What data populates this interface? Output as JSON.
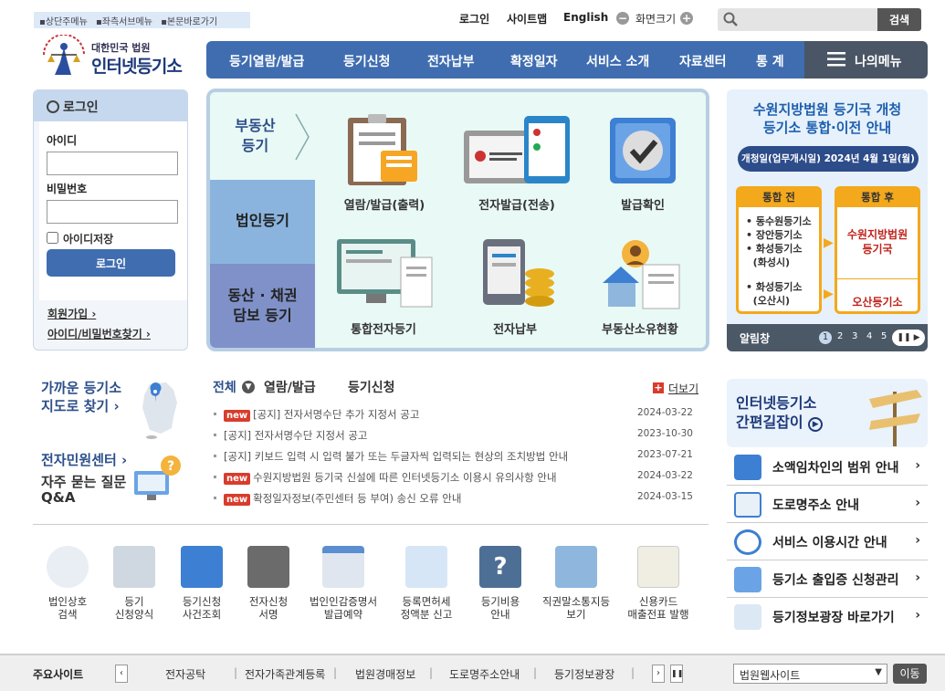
{
  "skip": [
    "상단주메뉴",
    "좌측서브메뉴",
    "본문바로가기"
  ],
  "util": {
    "login": "로그인",
    "sitemap": "사이트맵",
    "english": "English",
    "zoom_label": "화면크기",
    "zoom_minus": "−",
    "zoom_plus": "+",
    "search_button": "검색"
  },
  "logo": {
    "sub": "대한민국 법원",
    "main": "인터넷등기소"
  },
  "nav": {
    "items": [
      "등기열람/발급",
      "등기신청",
      "전자납부",
      "확정일자",
      "서비스 소개",
      "자료센터",
      "통 계"
    ],
    "my_menu": "나의메뉴"
  },
  "login": {
    "title": "로그인",
    "id_label": "아이디",
    "pw_label": "비밀번호",
    "save_id": "아이디저장",
    "button": "로그인",
    "join": "회원가입",
    "find": "아이디/비밀번호찾기"
  },
  "services": {
    "tabs": [
      "부동산\n등기",
      "법인등기",
      "동산 · 채권\n담보 등기"
    ],
    "items": [
      "열람/발급(출력)",
      "전자발급(전송)",
      "발급확인",
      "통합전자등기",
      "전자납부",
      "부동산소유현황"
    ]
  },
  "banner": {
    "title1": "수원지방법원 등기국 개청",
    "title2": "등기소 통합·이전 안내",
    "date": "개청일(업무개시일) 2024년 4월 1일(월)",
    "before": "통합 전",
    "after": "통합 후",
    "before_list1": "동수원등기소",
    "before_list2": "장안등기소",
    "before_list3": "화성등기소",
    "before_list4": "(화성시)",
    "before_list5": "화성등기소",
    "before_list6": "(오산시)",
    "after1": "수원지방법원\n등기국",
    "after2": "오산등기소",
    "footer": "알림창",
    "pages": [
      "1",
      "2",
      "3",
      "4",
      "5"
    ]
  },
  "quick": {
    "map1": "가까운 등기소",
    "map2": "지도로 찾기",
    "civil": "전자민원센터",
    "faq1": "자주 묻는 질문",
    "faq2": "Q&A"
  },
  "notice": {
    "tabs": [
      "전체",
      "열람/발급",
      "등기신청"
    ],
    "more": "더보기",
    "new_label": "new",
    "rows": [
      {
        "new": true,
        "text": "[공지] 전자서명수단 추가 지정서 공고",
        "date": "2024-03-22"
      },
      {
        "new": false,
        "text": "[공지] 전자서명수단 지정서 공고",
        "date": "2023-10-30"
      },
      {
        "new": false,
        "text": "[공지] 키보드 입력 시 입력 불가 또는 두글자씩 입력되는 현상의 조치방법 안내",
        "date": "2023-07-21"
      },
      {
        "new": true,
        "text": "수원지방법원 등기국 신설에 따른 인터넷등기소 이용시 유의사항 안내",
        "date": "2024-03-22"
      },
      {
        "new": true,
        "text": "확정일자정보(주민센터 등 부여) 송신 오류 안내",
        "date": "2024-03-15"
      }
    ]
  },
  "icons": [
    "법인상호\n검색",
    "등기\n신청양식",
    "등기신청\n사건조회",
    "전자신청\n서명",
    "법인인감증명서\n발급예약",
    "등록면허세\n정액분 신고",
    "등기비용\n안내",
    "직권말소통지등\n보기",
    "신용카드\n매출전표 발행"
  ],
  "easy": {
    "line1": "인터넷등기소",
    "line2": "간편길잡이"
  },
  "right_links": [
    "소액임차인의 범위 안내",
    "도로명주소 안내",
    "서비스 이용시간 안내",
    "등기소 출입증 신청관리",
    "등기정보광장 바로가기"
  ],
  "footer": {
    "label": "주요사이트",
    "sites": [
      "전자공탁",
      "전자가족관계등록",
      "법원경매정보",
      "도로명주소안내",
      "등기정보광장"
    ],
    "select": "법원웹사이트",
    "go": "이동"
  },
  "colors": {
    "nav": "#3f6db0",
    "new_badge": "#d83c2c"
  }
}
